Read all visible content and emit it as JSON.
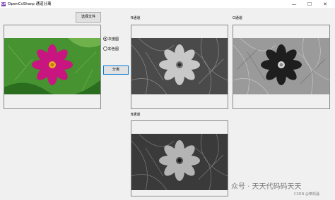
{
  "window": {
    "icon_text": "C#",
    "title": "OpenCvSharp 通道分离",
    "controls": [
      "—",
      "☐",
      "✕"
    ]
  },
  "buttons": {
    "choose_file": "选择文件",
    "separate": "分离"
  },
  "radio": {
    "grayscale_label": "灰度图",
    "color_label": "彩色图",
    "selected": "grayscale"
  },
  "channels": {
    "r_label": "R通道",
    "g_label": "G通道",
    "b_label": "B通道"
  },
  "watermark": {
    "text": "众号 · 天天代码码天天",
    "site": "CSDN @華頡誦"
  },
  "colors": {
    "flower": "#c8157f",
    "leaf": "#3b8a2a",
    "button_border": "#adadad"
  }
}
